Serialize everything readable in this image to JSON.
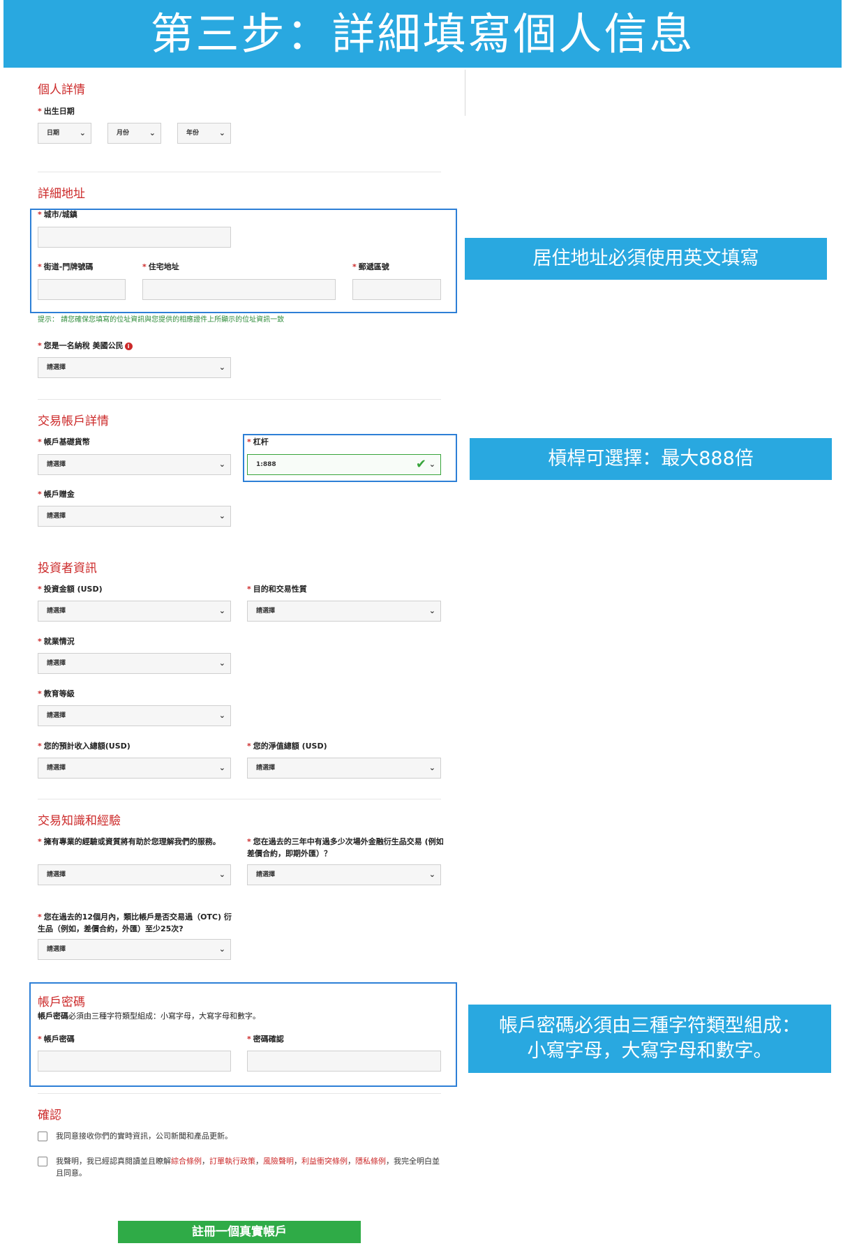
{
  "banner": {
    "title": "第三步：詳細填寫個人信息"
  },
  "sections": {
    "personal": "個人詳情",
    "address": "詳細地址",
    "account": "交易帳戶詳情",
    "investor": "投資者資訊",
    "knowledge": "交易知識和經驗",
    "password": "帳戶密碼",
    "confirm": "確認"
  },
  "personal": {
    "dob_label": "出生日期",
    "day": "日期",
    "month": "月份",
    "year": "年份"
  },
  "address": {
    "city_label": "城市/城鎮",
    "street_label": "街道-門牌號碼",
    "residence_label": "住宅地址",
    "postal_label": "郵遞區號",
    "hint": "提示：   請您確保您填寫的位址資訊與您提供的相應證件上所顯示的位址資訊一致",
    "us_label": "您是一名納稅 美國公民",
    "us_value": "請選擇"
  },
  "account": {
    "currency_label": "帳戶基礎貨幣",
    "currency_value": "請選擇",
    "leverage_label": "杠杆",
    "leverage_value": "1:888",
    "bonus_label": "帳戶贈金",
    "bonus_value": "請選擇"
  },
  "investor": {
    "amount_label": "投資金額 (USD)",
    "amount_value": "請選擇",
    "purpose_label": "目的和交易性質",
    "purpose_value": "請選擇",
    "employment_label": "就業情況",
    "employment_value": "請選擇",
    "education_label": "教育等級",
    "education_value": "請選擇",
    "income_label": "您的預計收入總額(USD)",
    "income_value": "請選擇",
    "networth_label": "您的淨值總額 (USD)",
    "networth_value": "請選擇"
  },
  "knowledge": {
    "q1_label": "擁有專業的經驗或資質將有助於您理解我們的服務。",
    "q1_value": "請選擇",
    "q2_label": "您在過去的三年中有過多少次場外金融衍生品交易 (例如差價合約，即期外匯）？",
    "q2_value": "請選擇",
    "q3_label": "您在過去的12個月內，類比帳戶是否交易過（OTC) 衍生品（例如，差價合約，外匯）至少25次?",
    "q3_value": "請選擇"
  },
  "password": {
    "note_bold": "帳戶密碼",
    "note_rest": "必須由三種字符類型組成：小寫字母，大寫字母和數字。",
    "pwd_label": "帳戶密碼",
    "confirm_label": "密碼確認"
  },
  "confirm": {
    "agree1": "我同意接收你們的實時資訊，公司新聞和產品更新。",
    "agree2_prefix": "我聲明，我已經認真閱讀並且瞭解",
    "link1": "綜合條例",
    "sep1": "，",
    "link2": "訂單執行政策",
    "sep2": "，",
    "link3": "風險聲明",
    "sep3": "，",
    "link4": "利益衝突條例",
    "sep4": "，",
    "link5": "隱私條例",
    "agree2_suffix": "，我完全明白並且同意。"
  },
  "submit_label": "註冊一個真實帳戶",
  "callouts": {
    "address": "居住地址必須使用英文填寫",
    "leverage": "槓桿可選擇：最大888倍",
    "password_line1": "帳戶密碼必須由三種字符類型組成：",
    "password_line2": "小寫字母，大寫字母和數字。"
  },
  "colors": {
    "banner": "#29a8e0",
    "section_title": "#cc2a2a",
    "highlight_border": "#2d7fd6",
    "submit": "#2fab47",
    "hint": "#2e8b3a"
  },
  "icons": {
    "select": "chevron-down-icon",
    "valid": "checkmark-icon",
    "info": "info-icon"
  }
}
